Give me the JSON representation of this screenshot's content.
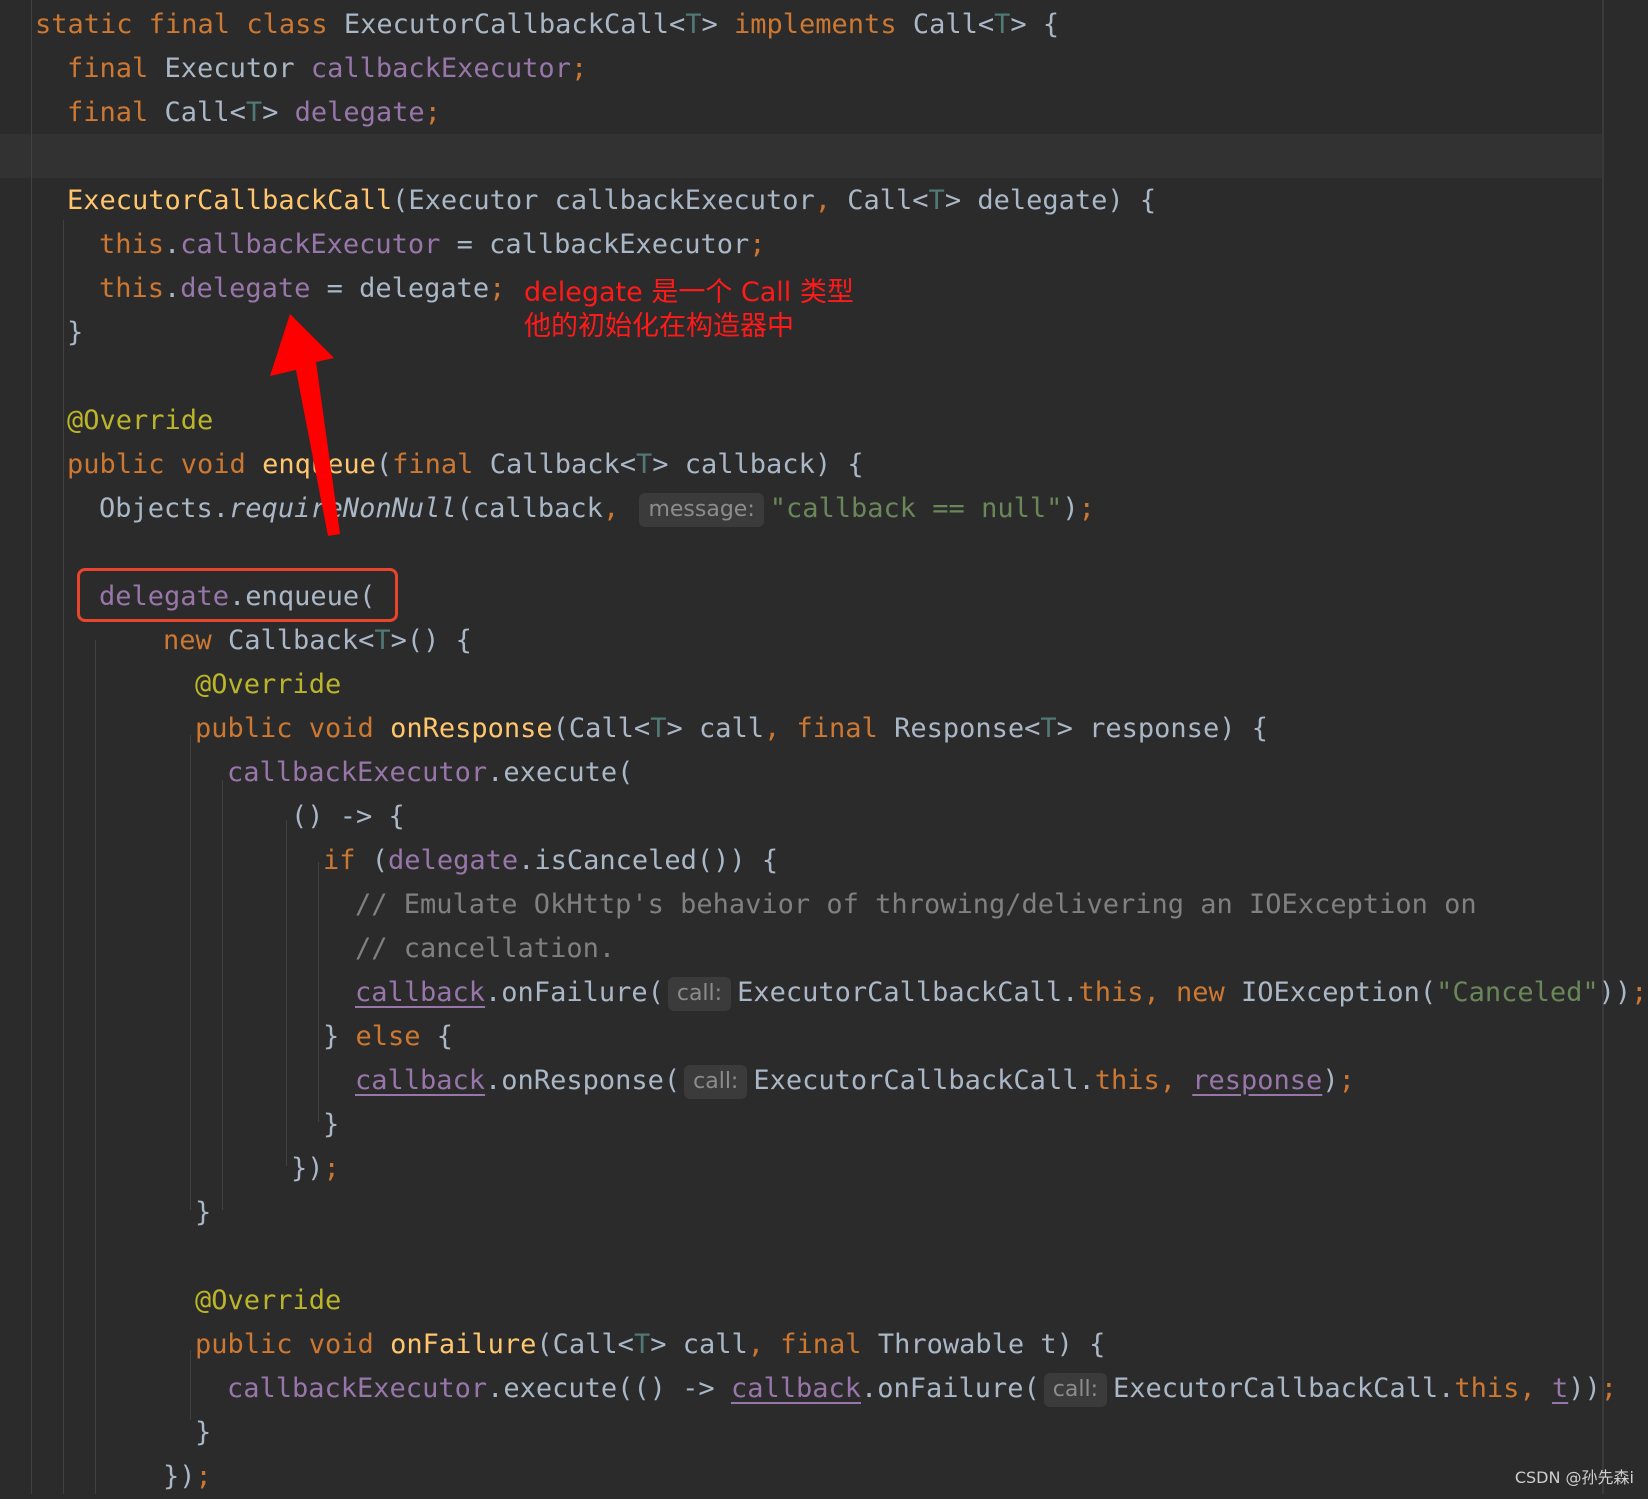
{
  "editor": {
    "lines": [
      {
        "indent": 1,
        "tokens": [
          {
            "t": "static final class ",
            "c": "kw"
          },
          {
            "t": "ExecutorCallbackCall<"
          },
          {
            "t": "T",
            "c": "tp"
          },
          {
            "t": "> "
          },
          {
            "t": "implements ",
            "c": "kw"
          },
          {
            "t": "Call<"
          },
          {
            "t": "T",
            "c": "tp"
          },
          {
            "t": "> {"
          }
        ]
      },
      {
        "indent": 2,
        "tokens": [
          {
            "t": "final ",
            "c": "kw"
          },
          {
            "t": "Executor "
          },
          {
            "t": "callbackExecutor",
            "c": "fld"
          },
          {
            "t": ";",
            "c": "kw"
          }
        ]
      },
      {
        "indent": 2,
        "tokens": [
          {
            "t": "final ",
            "c": "kw"
          },
          {
            "t": "Call<"
          },
          {
            "t": "T",
            "c": "tp"
          },
          {
            "t": "> "
          },
          {
            "t": "delegate",
            "c": "fld"
          },
          {
            "t": ";",
            "c": "kw"
          }
        ]
      },
      {
        "indent": 0,
        "tokens": []
      },
      {
        "indent": 2,
        "tokens": [
          {
            "t": "ExecutorCallbackCall",
            "c": "fn"
          },
          {
            "t": "(Executor callbackExecutor"
          },
          {
            "t": ", ",
            "c": "kw"
          },
          {
            "t": "Call<"
          },
          {
            "t": "T",
            "c": "tp"
          },
          {
            "t": "> delegate) {"
          }
        ]
      },
      {
        "indent": 3,
        "tokens": [
          {
            "t": "this",
            "c": "kw"
          },
          {
            "t": "."
          },
          {
            "t": "callbackExecutor",
            "c": "fld"
          },
          {
            "t": " = callbackExecutor"
          },
          {
            "t": ";",
            "c": "kw"
          }
        ]
      },
      {
        "indent": 3,
        "tokens": [
          {
            "t": "this",
            "c": "kw"
          },
          {
            "t": "."
          },
          {
            "t": "delegate",
            "c": "fld"
          },
          {
            "t": " = delegate"
          },
          {
            "t": ";",
            "c": "kw"
          }
        ]
      },
      {
        "indent": 2,
        "tokens": [
          {
            "t": "}"
          }
        ]
      },
      {
        "indent": 0,
        "tokens": []
      },
      {
        "indent": 2,
        "tokens": [
          {
            "t": "@Override",
            "c": "ann"
          }
        ]
      },
      {
        "indent": 2,
        "tokens": [
          {
            "t": "public void ",
            "c": "kw"
          },
          {
            "t": "enqueue",
            "c": "fn"
          },
          {
            "t": "("
          },
          {
            "t": "final ",
            "c": "kw"
          },
          {
            "t": "Callback<"
          },
          {
            "t": "T",
            "c": "tp"
          },
          {
            "t": "> callback) {"
          }
        ]
      },
      {
        "indent": 3,
        "tokens": [
          {
            "t": "Objects."
          },
          {
            "t": "requireNonNull",
            "c": "it"
          },
          {
            "t": "(callback"
          },
          {
            "t": ", ",
            "c": "kw"
          },
          {
            "hint": "message:"
          },
          {
            "t": "\"callback == null\"",
            "c": "str"
          },
          {
            "t": ")"
          },
          {
            "t": ";",
            "c": "kw"
          }
        ]
      },
      {
        "indent": 0,
        "tokens": []
      },
      {
        "indent": 3,
        "tokens": [
          {
            "t": "delegate",
            "c": "fld"
          },
          {
            "t": ".enqueue("
          }
        ]
      },
      {
        "indent": 5,
        "tokens": [
          {
            "t": "new ",
            "c": "kw"
          },
          {
            "t": "Callback<"
          },
          {
            "t": "T",
            "c": "tp"
          },
          {
            "t": ">() {"
          }
        ]
      },
      {
        "indent": 6,
        "tokens": [
          {
            "t": "@Override",
            "c": "ann"
          }
        ]
      },
      {
        "indent": 6,
        "tokens": [
          {
            "t": "public void ",
            "c": "kw"
          },
          {
            "t": "onResponse",
            "c": "fn"
          },
          {
            "t": "(Call<"
          },
          {
            "t": "T",
            "c": "tp"
          },
          {
            "t": "> call"
          },
          {
            "t": ", ",
            "c": "kw"
          },
          {
            "t": "final ",
            "c": "kw"
          },
          {
            "t": "Response<"
          },
          {
            "t": "T",
            "c": "tp"
          },
          {
            "t": "> response) {"
          }
        ]
      },
      {
        "indent": 7,
        "tokens": [
          {
            "t": "callbackExecutor",
            "c": "fld"
          },
          {
            "t": ".execute("
          }
        ]
      },
      {
        "indent": 9,
        "tokens": [
          {
            "t": "() -> {"
          }
        ]
      },
      {
        "indent": 10,
        "tokens": [
          {
            "t": "if ",
            "c": "kw"
          },
          {
            "t": "("
          },
          {
            "t": "delegate",
            "c": "fld"
          },
          {
            "t": ".isCanceled()) {"
          }
        ]
      },
      {
        "indent": 11,
        "tokens": [
          {
            "t": "// Emulate OkHttp's behavior of throwing/delivering an IOException on",
            "c": "cmt"
          }
        ]
      },
      {
        "indent": 11,
        "tokens": [
          {
            "t": "// cancellation.",
            "c": "cmt"
          }
        ]
      },
      {
        "indent": 11,
        "tokens": [
          {
            "t": "callback",
            "c": "fld ul"
          },
          {
            "t": ".onFailure("
          },
          {
            "hint": "call:"
          },
          {
            "t": "ExecutorCallbackCall."
          },
          {
            "t": "this, new ",
            "c": "kw"
          },
          {
            "t": "IOException("
          },
          {
            "t": "\"Canceled\"",
            "c": "str"
          },
          {
            "t": "))"
          },
          {
            "t": ";",
            "c": "kw"
          }
        ]
      },
      {
        "indent": 10,
        "tokens": [
          {
            "t": "} "
          },
          {
            "t": "else ",
            "c": "kw"
          },
          {
            "t": "{"
          }
        ]
      },
      {
        "indent": 11,
        "tokens": [
          {
            "t": "callback",
            "c": "fld ul"
          },
          {
            "t": ".onResponse("
          },
          {
            "hint": "call:"
          },
          {
            "t": "ExecutorCallbackCall."
          },
          {
            "t": "this, ",
            "c": "kw"
          },
          {
            "t": "response",
            "c": "fld ul"
          },
          {
            "t": ")"
          },
          {
            "t": ";",
            "c": "kw"
          }
        ]
      },
      {
        "indent": 10,
        "tokens": [
          {
            "t": "}"
          }
        ]
      },
      {
        "indent": 9,
        "tokens": [
          {
            "t": "})"
          },
          {
            "t": ";",
            "c": "kw"
          }
        ]
      },
      {
        "indent": 6,
        "tokens": [
          {
            "t": "}"
          }
        ]
      },
      {
        "indent": 0,
        "tokens": []
      },
      {
        "indent": 6,
        "tokens": [
          {
            "t": "@Override",
            "c": "ann"
          }
        ]
      },
      {
        "indent": 6,
        "tokens": [
          {
            "t": "public void ",
            "c": "kw"
          },
          {
            "t": "onFailure",
            "c": "fn"
          },
          {
            "t": "(Call<"
          },
          {
            "t": "T",
            "c": "tp"
          },
          {
            "t": "> call"
          },
          {
            "t": ", ",
            "c": "kw"
          },
          {
            "t": "final ",
            "c": "kw"
          },
          {
            "t": "Throwable t) {"
          }
        ]
      },
      {
        "indent": 7,
        "tokens": [
          {
            "t": "callbackExecutor",
            "c": "fld"
          },
          {
            "t": ".execute(() -> "
          },
          {
            "t": "callback",
            "c": "fld ul"
          },
          {
            "t": ".onFailure("
          },
          {
            "hint": "call:"
          },
          {
            "t": "ExecutorCallbackCall."
          },
          {
            "t": "this, ",
            "c": "kw"
          },
          {
            "t": "t",
            "c": "fld ul"
          },
          {
            "t": "))"
          },
          {
            "t": ";",
            "c": "kw"
          }
        ]
      },
      {
        "indent": 6,
        "tokens": [
          {
            "t": "}"
          }
        ]
      },
      {
        "indent": 5,
        "tokens": [
          {
            "t": "})"
          },
          {
            "t": ";",
            "c": "kw"
          }
        ]
      }
    ]
  },
  "annotation": {
    "line1": "delegate 是一个 Call 类型",
    "line2": "他的初始化在构造器中"
  },
  "arrow_color": "#ff0000",
  "box_color": "#e8452c",
  "watermark": "CSDN @孙先森i"
}
